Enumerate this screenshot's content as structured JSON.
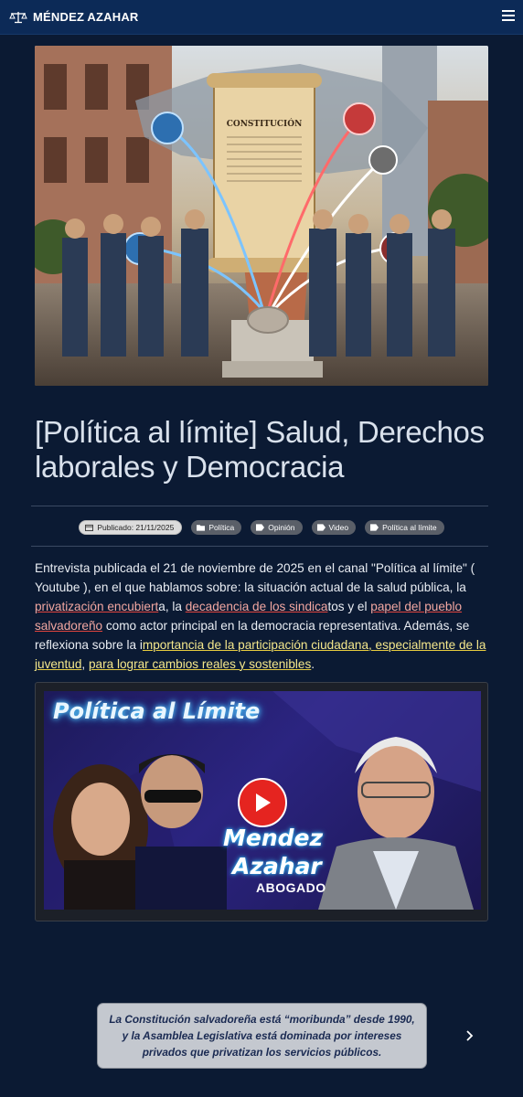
{
  "header": {
    "title": "MÉNDEZ AZAHAR",
    "logo_icon": "scales-icon",
    "menu_icon": "hamburger-icon",
    "bg_color": "#0c2a57"
  },
  "hero": {
    "scroll_text": "CONSTITUCIÓN"
  },
  "article": {
    "title": "[Política al límite] Salud, Derechos laborales y Democracia",
    "published": "Publicado: 21/11/2025",
    "tags": [
      "Política",
      "Opinión",
      "Video",
      "Política al límite"
    ],
    "body": {
      "p1": "Entrevista publicada el 21 de noviembre de 2025 en el canal \"Política al límite\" ( Youtube ), en el que hablamos sobre: la situación actual de la salud pública, la ",
      "h1": "privatización encubiert",
      "p2": "a, la ",
      "h2": "decadencia de los sindica",
      "p3": "tos y el ",
      "h3": "papel del pueblo salvadoreño",
      "p4": " como actor principal en la democracia representativa. Además, se reflexiona sobre la i",
      "h4": "mportancia de la participación ciudadana, especialmente de la juventud",
      "p5": ", ",
      "h5": "para lograr cambios reales y sostenibles",
      "p6": "."
    }
  },
  "video": {
    "title": "Política al Límite",
    "name_line1": "Mendez",
    "name_line2": "Azahar",
    "subtitle": "ABOGADO",
    "play_icon": "play-icon",
    "accent_color": "#e52420"
  },
  "note": {
    "text": "La Constitución salvadoreña está “moribunda” desde 1990, y la Asamblea Legislativa está dominada por intereses privados que privatizan los servicios públicos."
  },
  "colors": {
    "page_bg": "#0b1a33",
    "underline_red": "#e0443d",
    "underline_yellow": "#e8cc3e"
  }
}
